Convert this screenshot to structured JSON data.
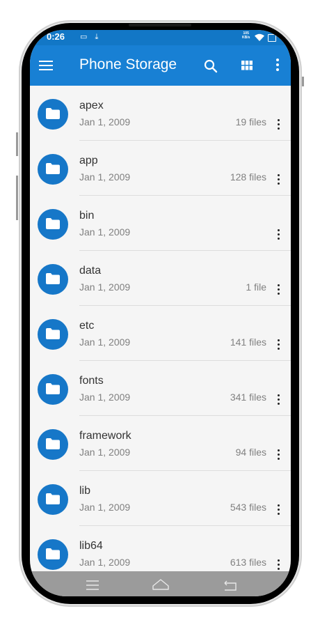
{
  "status_bar": {
    "time": "0:26",
    "notification_icons": "▭ ⤓",
    "net_speed_value": "105",
    "net_speed_unit": "KB/s"
  },
  "app_bar": {
    "title": "Phone Storage",
    "icons": [
      "menu-icon",
      "search-icon",
      "grid-view-icon",
      "more-vert-icon"
    ]
  },
  "files": [
    {
      "name": "apex",
      "date": "Jan 1, 2009",
      "count": "19 files"
    },
    {
      "name": "app",
      "date": "Jan 1, 2009",
      "count": "128 files"
    },
    {
      "name": "bin",
      "date": "Jan 1, 2009",
      "count": ""
    },
    {
      "name": "data",
      "date": "Jan 1, 2009",
      "count": "1 file"
    },
    {
      "name": "etc",
      "date": "Jan 1, 2009",
      "count": "141 files"
    },
    {
      "name": "fonts",
      "date": "Jan 1, 2009",
      "count": "341 files"
    },
    {
      "name": "framework",
      "date": "Jan 1, 2009",
      "count": "94 files"
    },
    {
      "name": "lib",
      "date": "Jan 1, 2009",
      "count": "543 files"
    },
    {
      "name": "lib64",
      "date": "Jan 1, 2009",
      "count": "613 files"
    }
  ],
  "nav_bar": {
    "buttons": [
      "recents-icon",
      "home-icon",
      "back-icon"
    ]
  },
  "colors": {
    "accent": "#1880d4",
    "status_bar": "#1277c6",
    "folder_icon_bg": "#1677c8",
    "list_bg": "#f5f5f5",
    "nav_bar": "#9b9b9b"
  }
}
